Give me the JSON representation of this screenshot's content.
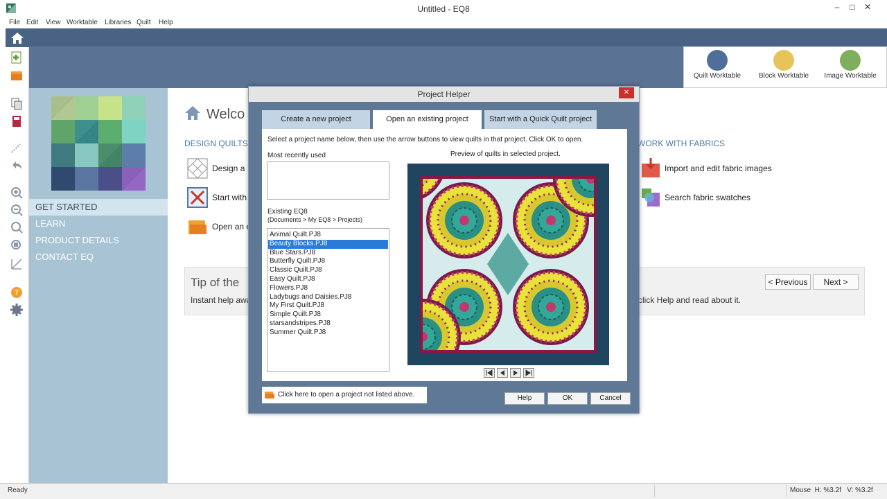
{
  "window": {
    "title": "Untitled - EQ8",
    "minimize_glyph": "–",
    "maximize_glyph": "□",
    "close_glyph": "✕"
  },
  "menu": [
    "File",
    "Edit",
    "View",
    "Worktable",
    "Libraries",
    "Quilt",
    "Help"
  ],
  "toolbar_icons": [
    "home-icon",
    "new-quilt-icon",
    "open-project-icon",
    "copy-icon",
    "book-icon",
    "pencil-icon",
    "undo-icon",
    "zoom-in-icon",
    "zoom-out-icon",
    "zoom-fit-icon",
    "zoom-box-icon",
    "ruler-icon",
    "help-icon",
    "settings-icon"
  ],
  "worktables": [
    {
      "label": "Quilt Worktable",
      "color": "#4f6f9a"
    },
    {
      "label": "Block Worktable",
      "color": "#e8c35a"
    },
    {
      "label": "Image Worktable",
      "color": "#7fae5c"
    }
  ],
  "nav": {
    "items": [
      "GET STARTED",
      "LEARN",
      "PRODUCT DETAILS",
      "CONTACT EQ"
    ],
    "active": "GET STARTED"
  },
  "welcome": {
    "title": "Welco",
    "design_section": "DESIGN QUILTS",
    "design_rows": [
      "Design a",
      "Start with",
      "Open an e"
    ],
    "fabrics_section": "WORK WITH FABRICS",
    "fabric_rows": [
      "Import and edit fabric images",
      "Search fabric swatches"
    ],
    "tip_title": "Tip of the",
    "tip_text_left": "Instant help awa",
    "tip_text_right": "click Help and read about it.",
    "prev_label": "< Previous",
    "next_label": "Next >"
  },
  "dialog": {
    "title": "Project Helper",
    "close_glyph": "✕",
    "tabs": [
      "Create a new project",
      "Open an existing project",
      "Start with a Quick Quilt project"
    ],
    "active_tab": "Open an existing project",
    "instructions": "Select a project name below, then use the arrow buttons to view quilts in that project. Click OK to open.",
    "recent_label": "Most recently used",
    "existing_label": "Existing EQ8",
    "existing_path": "(Documents > My EQ8 > Projects)",
    "projects": [
      "Animal Quilt.PJ8",
      "Beauty Blocks.PJ8",
      "Blue Stars.PJ8",
      "Butterfly Quilt.PJ8",
      "Classic Quilt.PJ8",
      "Easy Quilt.PJ8",
      "Flowers.PJ8",
      "Ladybugs and Daisies.PJ8",
      "My First Quilt.PJ8",
      "Simple Quilt.PJ8",
      "starsandstripes.PJ8",
      "Summer Quilt.PJ8"
    ],
    "selected_project": "Beauty Blocks.PJ8",
    "preview_label": "Preview of quilts in selected project.",
    "open_other_label": "Click here to open a project not listed above.",
    "help_label": "Help",
    "ok_label": "OK",
    "cancel_label": "Cancel"
  },
  "status": {
    "ready": "Ready",
    "mouse": "Mouse  H: %3.2f   V: %3.2f"
  },
  "colors": {
    "banner": "#5a7294",
    "nav_panel": "#a8c4d4",
    "dialog_frame": "#5f7896",
    "selection": "#2a7bd9",
    "section_title": "#4b79a8"
  }
}
